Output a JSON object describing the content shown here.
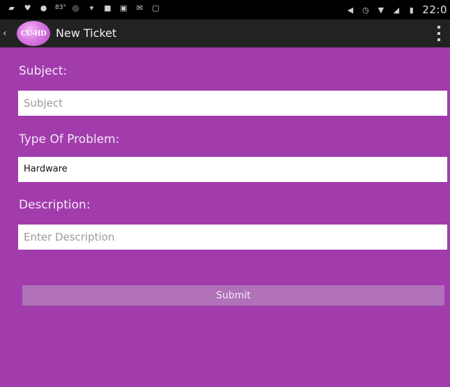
{
  "status_bar": {
    "clock": "22:0",
    "icons_left": [
      "image-icon",
      "twitter-icon",
      "chat-icon",
      "temperature-icon",
      "circle-badge-icon",
      "wifi-icon",
      "app-icon",
      "app2-icon",
      "mail-icon",
      "gallery-icon"
    ],
    "temperature": "83°",
    "icons_right": [
      "mute-icon",
      "alarm-icon",
      "wifi-icon",
      "signal-icon",
      "battery-icon"
    ]
  },
  "action_bar": {
    "back_glyph": "‹",
    "logo_text": "CU-HD",
    "title": "New Ticket"
  },
  "form": {
    "subject_label": "Subject:",
    "subject_placeholder": "Subject",
    "type_label": "Type Of Problem:",
    "type_value": "Hardware",
    "description_label": "Description:",
    "description_placeholder": "Enter Description",
    "submit_label": "Submit"
  },
  "colors": {
    "background": "#a23cad",
    "action_bar": "#222222",
    "submit_button": "#b071b9"
  }
}
